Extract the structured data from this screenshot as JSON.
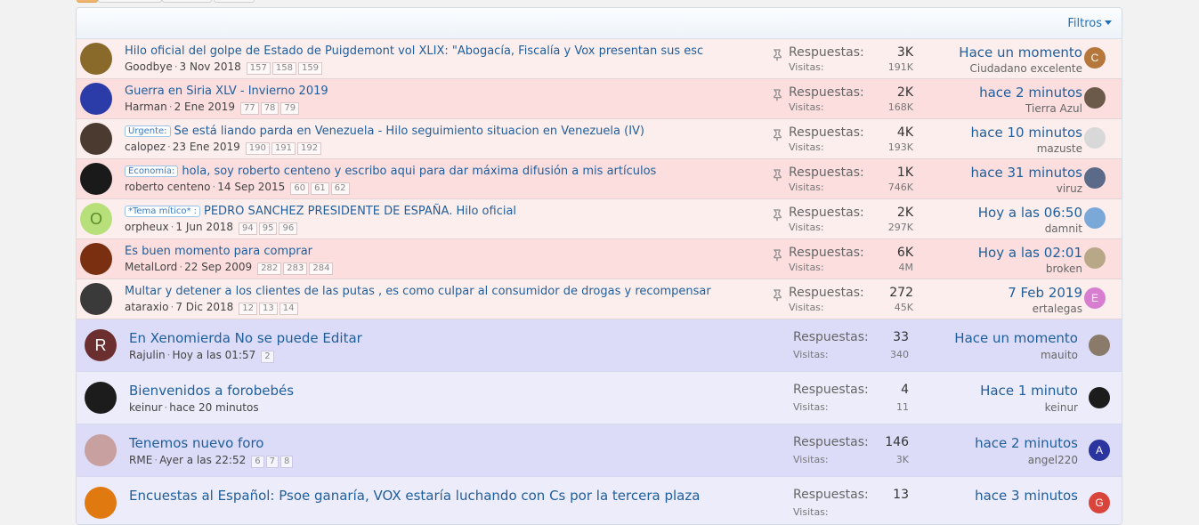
{
  "header": {
    "filters_label": "Filtros"
  },
  "labels": {
    "respuestas": "Respuestas:",
    "visitas": "Visitas:"
  },
  "threads": [
    {
      "kind": "sticky",
      "shade": "a",
      "prefix": "",
      "title": "Hilo oficial del golpe de Estado de Puigdemont vol XLIX: \"Abogacía, Fiscalía y Vox presentan sus esc",
      "author": "Goodbye",
      "date": "3 Nov 2018",
      "pages": [
        "157",
        "158",
        "159"
      ],
      "replies": "3K",
      "views": "191K",
      "last_time": "Hace un momento",
      "last_user": "Ciudadano excelente",
      "avatar_letter": "",
      "avatar_color": "#8a6a2a",
      "last_letter": "C",
      "last_color": "#b5773b"
    },
    {
      "kind": "sticky",
      "shade": "b",
      "prefix": "",
      "title": "Guerra en Siria XLV - Invierno 2019",
      "author": "Harman",
      "date": "2 Ene 2019",
      "pages": [
        "77",
        "78",
        "79"
      ],
      "replies": "2K",
      "views": "168K",
      "last_time": "hace 2 minutos",
      "last_user": "Tierra Azul",
      "avatar_letter": "",
      "avatar_color": "#2b3ca8",
      "last_letter": "",
      "last_color": "#6b5a4a"
    },
    {
      "kind": "sticky",
      "shade": "a",
      "prefix": "Urgente:",
      "title": "Se está liando parda en Venezuela - Hilo seguimiento situacion en Venezuela (IV)",
      "author": "calopez",
      "date": "23 Ene 2019",
      "pages": [
        "190",
        "191",
        "192"
      ],
      "replies": "4K",
      "views": "193K",
      "last_time": "hace 10 minutos",
      "last_user": "mazuste",
      "avatar_letter": "",
      "avatar_color": "#4a3a30",
      "last_letter": "",
      "last_color": "#d8d8d8"
    },
    {
      "kind": "sticky",
      "shade": "b",
      "prefix": "Economía:",
      "title": "hola, soy roberto centeno y escribo aqui para dar máxima difusión a mis artículos",
      "author": "roberto centeno",
      "date": "14 Sep 2015",
      "pages": [
        "60",
        "61",
        "62"
      ],
      "replies": "1K",
      "views": "746K",
      "last_time": "hace 31 minutos",
      "last_user": "viruz",
      "avatar_letter": "",
      "avatar_color": "#1a1a1a",
      "last_letter": "",
      "last_color": "#5a6a88"
    },
    {
      "kind": "sticky",
      "shade": "a",
      "prefix": "*Tema mítico* :",
      "title": "PEDRO SANCHEZ PRESIDENTE DE ESPAÑA. Hilo oficial",
      "author": "orpheux",
      "date": "1 Jun 2018",
      "pages": [
        "94",
        "95",
        "96"
      ],
      "replies": "2K",
      "views": "297K",
      "last_time": "Hoy a las 06:50",
      "last_user": "damnit",
      "avatar_letter": "O",
      "avatar_color": "#b8e07a",
      "last_letter": "",
      "last_color": "#7aa8d8"
    },
    {
      "kind": "sticky",
      "shade": "b",
      "prefix": "",
      "title": "Es buen momento para comprar",
      "author": "MetalLord",
      "date": "22 Sep 2009",
      "pages": [
        "282",
        "283",
        "284"
      ],
      "replies": "6K",
      "views": "4M",
      "last_time": "Hoy a las 02:01",
      "last_user": "broken",
      "avatar_letter": "",
      "avatar_color": "#7a3010",
      "last_letter": "",
      "last_color": "#b8a888"
    },
    {
      "kind": "sticky",
      "shade": "a",
      "prefix": "",
      "title": "Multar y detener a los clientes de las putas , es como culpar al consumidor de drogas y recompensar",
      "author": "ataraxio",
      "date": "7 Dic 2018",
      "pages": [
        "12",
        "13",
        "14"
      ],
      "replies": "272",
      "views": "45K",
      "last_time": "7 Feb 2019",
      "last_user": "ertalegas",
      "avatar_letter": "",
      "avatar_color": "#3a3a3a",
      "last_letter": "E",
      "last_color": "#d77ed0"
    },
    {
      "kind": "normal",
      "shade": "a",
      "prefix": "",
      "title": "En Xenomierda No se puede Editar",
      "author": "Rajulin",
      "date": "Hoy a las 01:57",
      "pages": [
        "2"
      ],
      "replies": "33",
      "views": "340",
      "last_time": "Hace un momento",
      "last_user": "mauito",
      "avatar_letter": "R",
      "avatar_color": "#6b2f2f",
      "last_letter": "",
      "last_color": "#8a7a6a"
    },
    {
      "kind": "normal",
      "shade": "b",
      "prefix": "",
      "title": "Bienvenidos a forobebés",
      "author": "keinur",
      "date": "hace 20 minutos",
      "pages": [],
      "replies": "4",
      "views": "11",
      "last_time": "Hace 1 minuto",
      "last_user": "keinur",
      "avatar_letter": "",
      "avatar_color": "#1c1c1c",
      "last_letter": "",
      "last_color": "#1c1c1c"
    },
    {
      "kind": "normal",
      "shade": "a",
      "prefix": "",
      "title": "Tenemos nuevo foro",
      "author": "RME",
      "date": "Ayer a las 22:52",
      "pages": [
        "6",
        "7",
        "8"
      ],
      "replies": "146",
      "views": "3K",
      "last_time": "hace 2 minutos",
      "last_user": "angel220",
      "avatar_letter": "",
      "avatar_color": "#c9a0a0",
      "last_letter": "A",
      "last_color": "#2b35a0"
    },
    {
      "kind": "normal",
      "shade": "b",
      "prefix": "",
      "title": "Encuestas al Español: Psoe ganaría, VOX estaría luchando con Cs por la tercera plaza",
      "author": "",
      "date": "",
      "pages": [],
      "replies": "13",
      "views": "",
      "last_time": "hace 3 minutos",
      "last_user": "",
      "avatar_letter": "",
      "avatar_color": "#e07a10",
      "last_letter": "G",
      "last_color": "#d9453a"
    }
  ]
}
